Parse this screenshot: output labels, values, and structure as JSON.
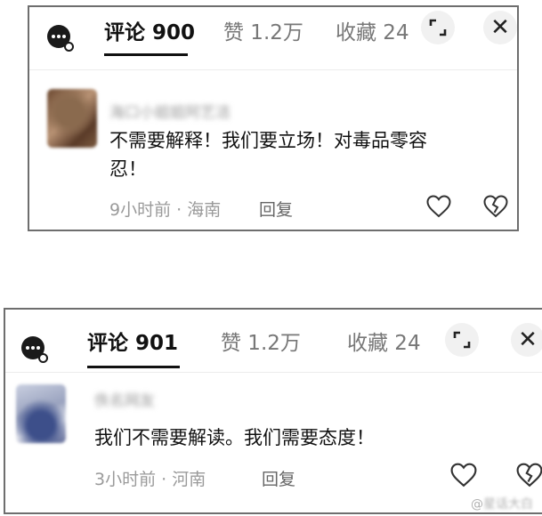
{
  "screenshots": [
    {
      "tabs": {
        "comments": "评论 900",
        "likes": "赞 1.2万",
        "favorites": "收藏 24"
      },
      "comment": {
        "author": "海口小姐姐阿艺洁",
        "text_line1": "不需要解释！我们要立场！对毒品零容",
        "text_line2": "忍！",
        "time": "9小时前",
        "sep": "·",
        "location": "海南",
        "reply": "回复"
      }
    },
    {
      "tabs": {
        "comments": "评论 901",
        "likes": "赞 1.2万",
        "favorites": "收藏 24"
      },
      "comment": {
        "author": "佚名网友",
        "text_line1": "我们不需要解读。我们需要态度！",
        "time": "3小时前",
        "sep": "·",
        "location": "河南",
        "reply": "回复"
      }
    }
  ],
  "watermark": {
    "prefix": "@",
    "name": "星话大白"
  },
  "icons": [
    "comment-menu-icon",
    "expand-icon",
    "close-icon",
    "like-icon",
    "dislike-icon"
  ]
}
